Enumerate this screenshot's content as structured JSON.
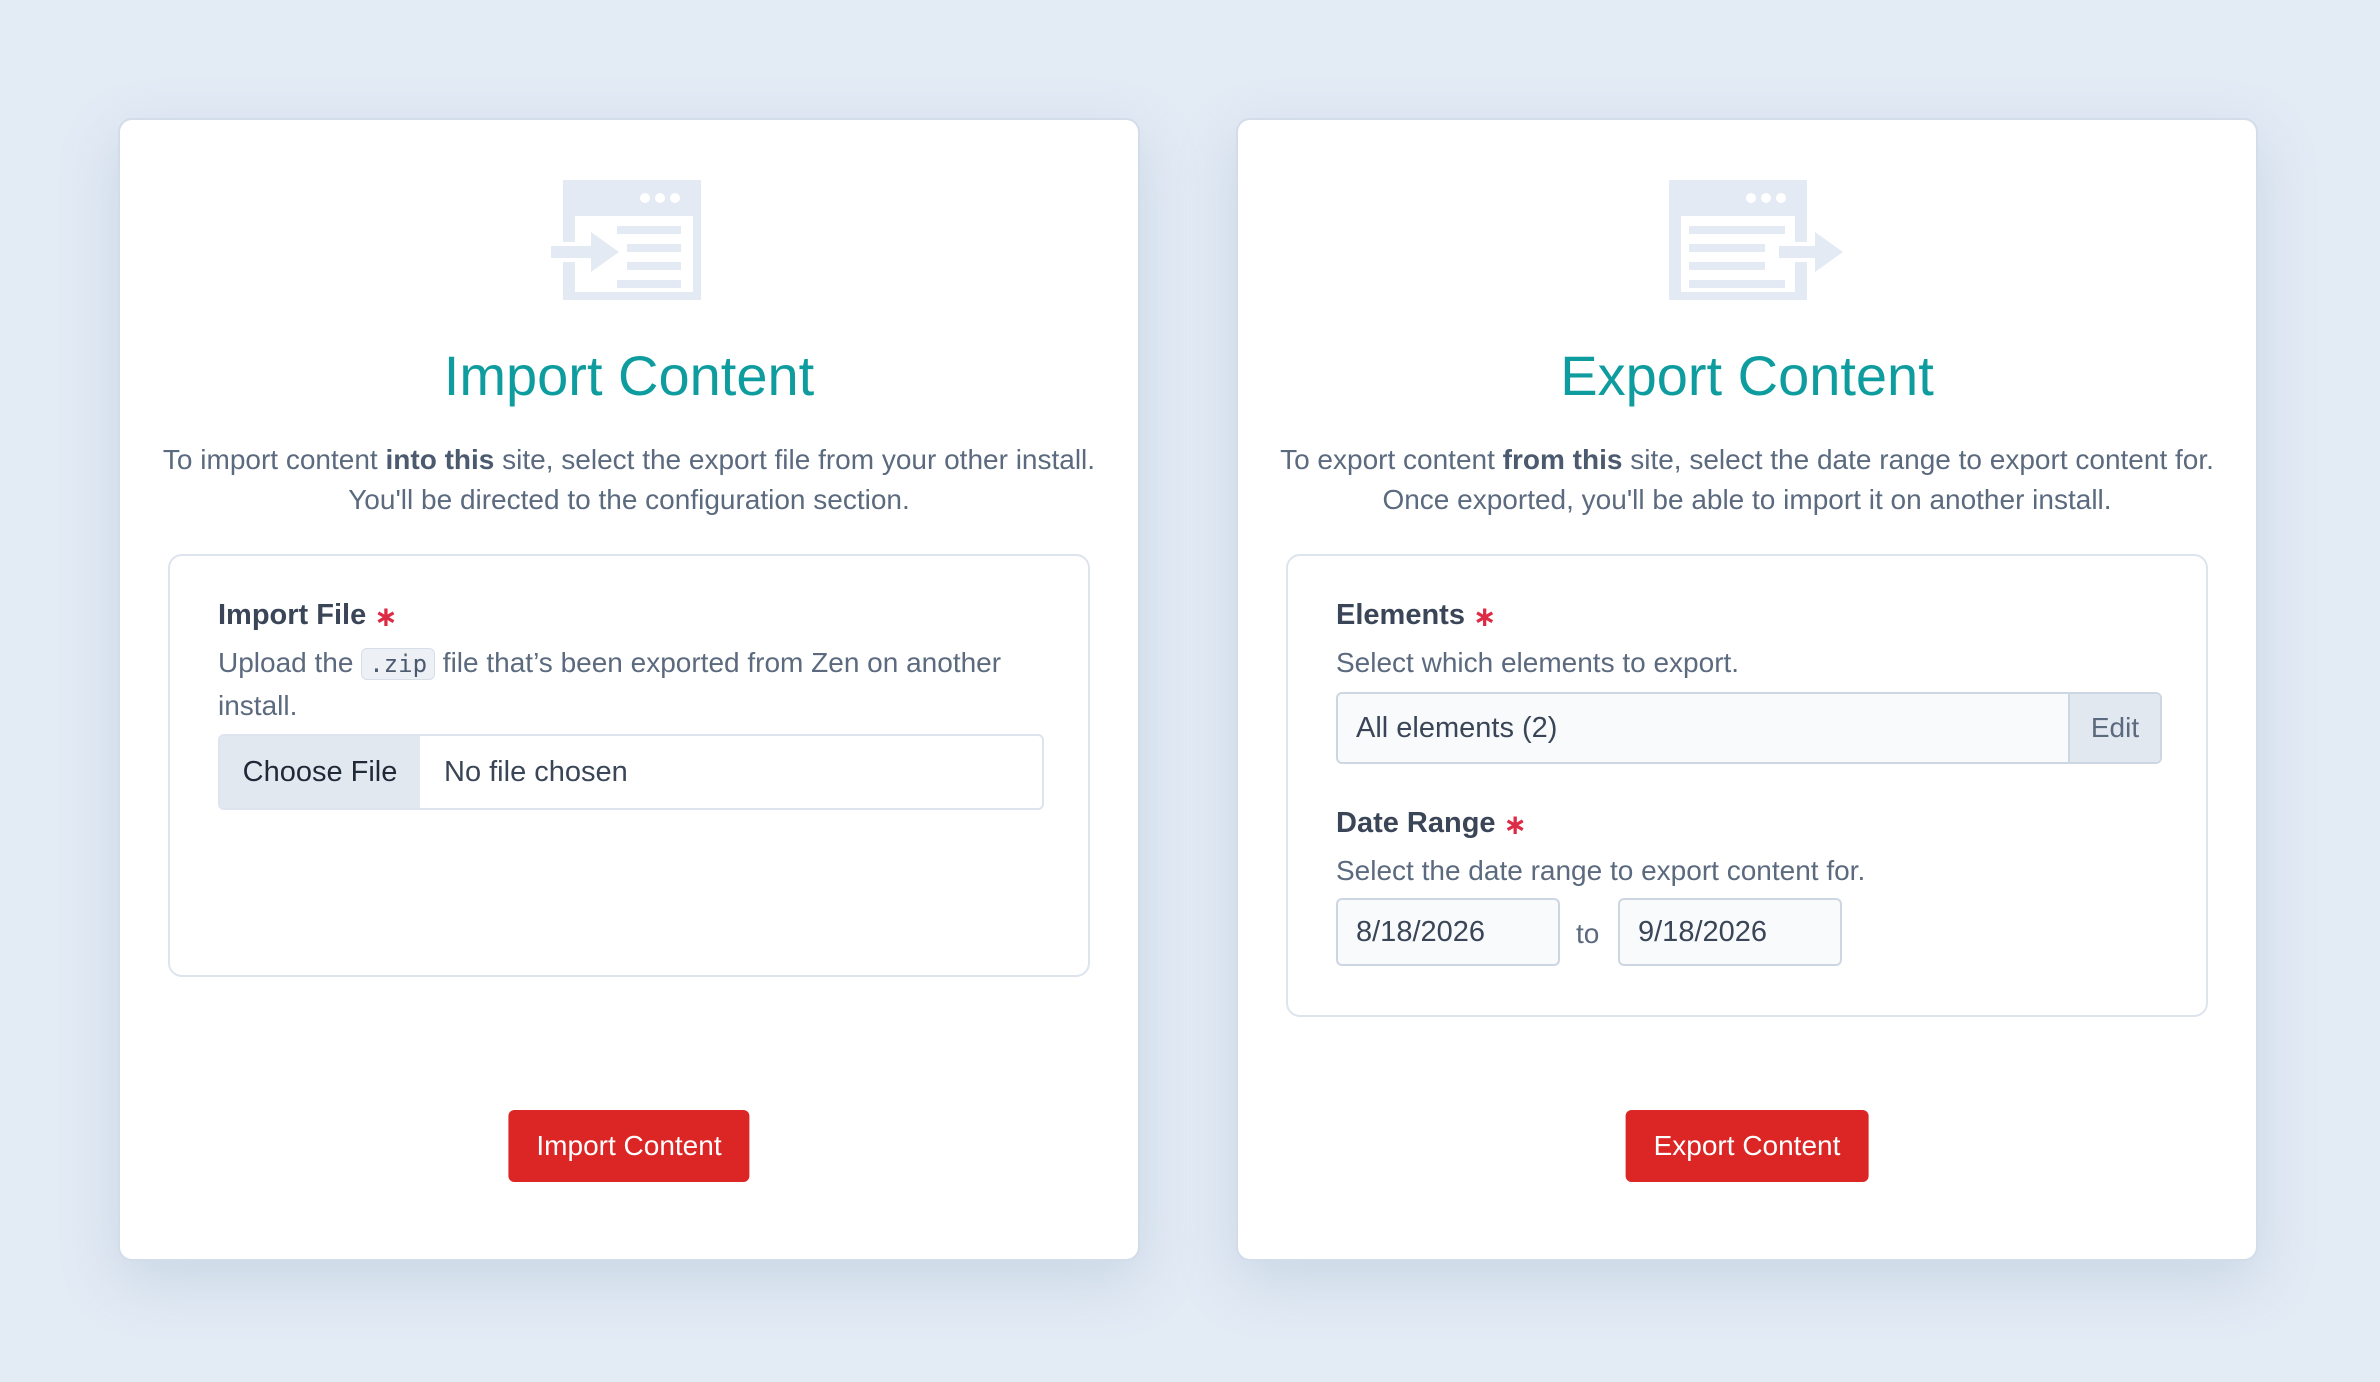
{
  "import": {
    "icon": "import-content-icon",
    "title": "Import Content",
    "desc": {
      "pre": "To import content ",
      "bold": "into this",
      "post": " site, select the export file from your other install. You'll be directed to the configuration section."
    },
    "file_field": {
      "label": "Import File",
      "required_mark": "∗",
      "help_pre": "Upload the ",
      "help_code": ".zip",
      "help_post": " file that’s been exported from Zen on another install.",
      "button_label": "Choose File",
      "status": "No file chosen"
    },
    "submit_label": "Import Content"
  },
  "export": {
    "icon": "export-content-icon",
    "title": "Export Content",
    "desc": {
      "pre": "To export content ",
      "bold": "from this",
      "post": " site, select the date range to export content for. Once exported, you'll be able to import it on another install."
    },
    "elements_field": {
      "label": "Elements",
      "required_mark": "∗",
      "help": "Select which elements to export.",
      "value": "All elements (2)",
      "edit_label": "Edit"
    },
    "date_field": {
      "label": "Date Range",
      "required_mark": "∗",
      "help": "Select the date range to export content for.",
      "start": "8/18/2026",
      "separator": "to",
      "end": "9/18/2026"
    },
    "submit_label": "Export Content"
  },
  "colors": {
    "accent": "#0e9c9e",
    "danger": "#dc2626",
    "required": "#dd2a45",
    "background": "#e3ebf5"
  }
}
